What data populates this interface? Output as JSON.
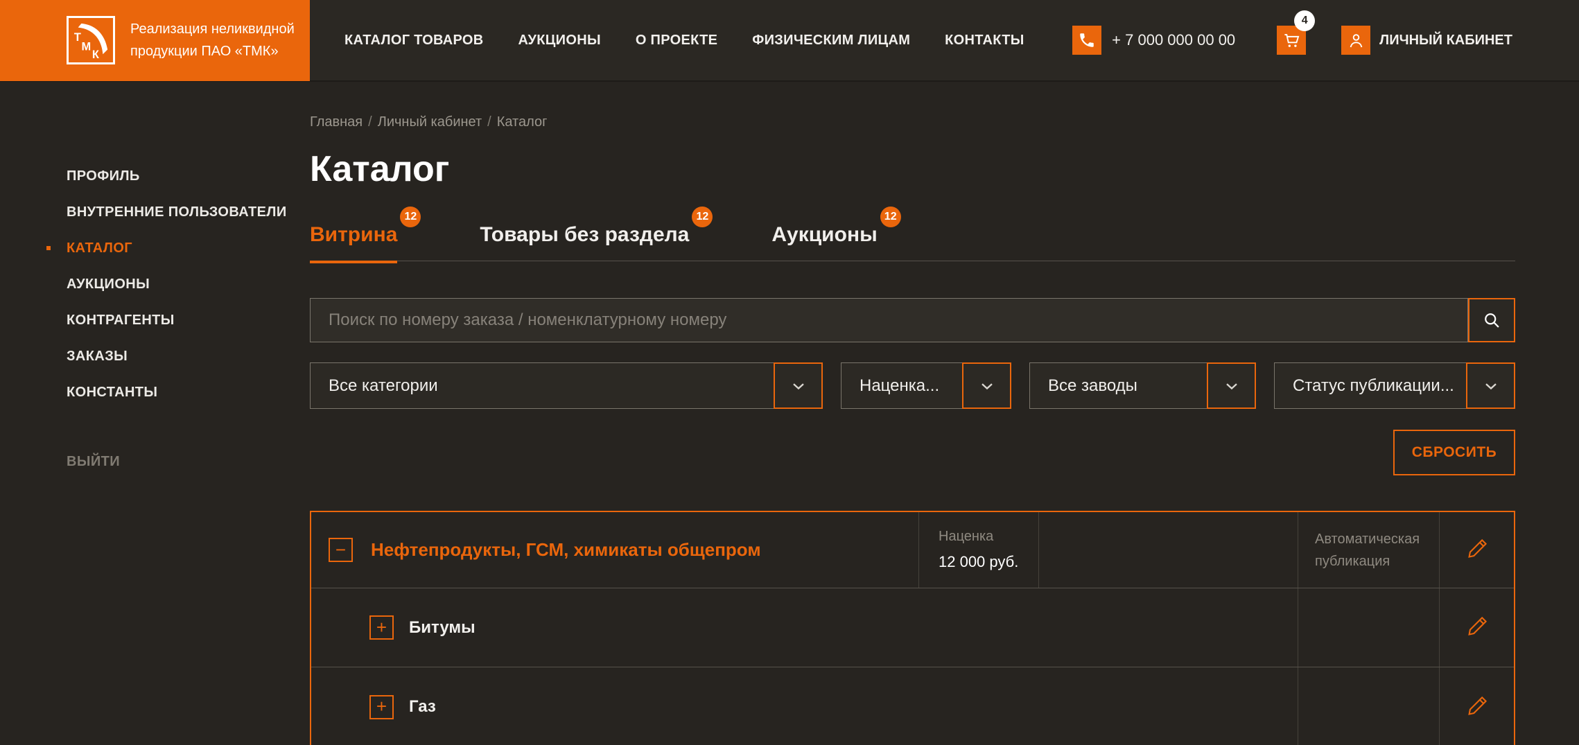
{
  "brand": {
    "logo_text": "ТМК",
    "tagline_line1": "Реализация неликвидной",
    "tagline_line2": "продукции ПАО «ТМК»"
  },
  "header": {
    "nav": [
      {
        "label": "КАТАЛОГ ТОВАРОВ"
      },
      {
        "label": "АУКЦИОНЫ"
      },
      {
        "label": "О ПРОЕКТЕ"
      },
      {
        "label": "ФИЗИЧЕСКИМ ЛИЦАМ"
      },
      {
        "label": "КОНТАКТЫ"
      }
    ],
    "phone": "+ 7 000 000 00 00",
    "cart_badge": "4",
    "account_label": "ЛИЧНЫЙ КАБИНЕТ"
  },
  "sidebar": {
    "items": [
      {
        "label": "ПРОФИЛЬ"
      },
      {
        "label": "ВНУТРЕННИЕ ПОЛЬЗОВАТЕЛИ"
      },
      {
        "label": "КАТАЛОГ"
      },
      {
        "label": "АУКЦИОНЫ"
      },
      {
        "label": "КОНТРАГЕНТЫ"
      },
      {
        "label": "ЗАКАЗЫ"
      },
      {
        "label": "КОНСТАНТЫ"
      }
    ],
    "logout_label": "ВЫЙТИ"
  },
  "breadcrumb": {
    "items": [
      {
        "label": "Главная"
      },
      {
        "label": "Личный кабинет"
      },
      {
        "label": "Каталог"
      }
    ],
    "separator": "/"
  },
  "page": {
    "title": "Каталог"
  },
  "tabs": [
    {
      "label": "Витрина",
      "badge": "12"
    },
    {
      "label": "Товары без раздела",
      "badge": "12"
    },
    {
      "label": "Аукционы",
      "badge": "12"
    }
  ],
  "search": {
    "placeholder": "Поиск по номеру заказа / номенклатурному номеру"
  },
  "filters": [
    {
      "value": "Все категории"
    },
    {
      "value": "Наценка..."
    },
    {
      "value": "Все заводы"
    },
    {
      "value": "Статус публикации..."
    }
  ],
  "reset_button": "СБРОСИТЬ",
  "table": {
    "rows": [
      {
        "name": "Нефтепродукты, ГСМ, химикаты общепром",
        "toggle": "−",
        "markup_label": "Наценка",
        "markup_value": "12 000 руб.",
        "publication": "Автоматическая публикация"
      },
      {
        "name": "Битумы",
        "toggle": "+"
      },
      {
        "name": "Газ",
        "toggle": "+"
      }
    ]
  },
  "colors": {
    "accent": "#EA660C",
    "header_bg": "#2B2823",
    "body_bg": "#272420",
    "text_grey": "#8F8A81",
    "badge_bg": "#EA660C"
  }
}
